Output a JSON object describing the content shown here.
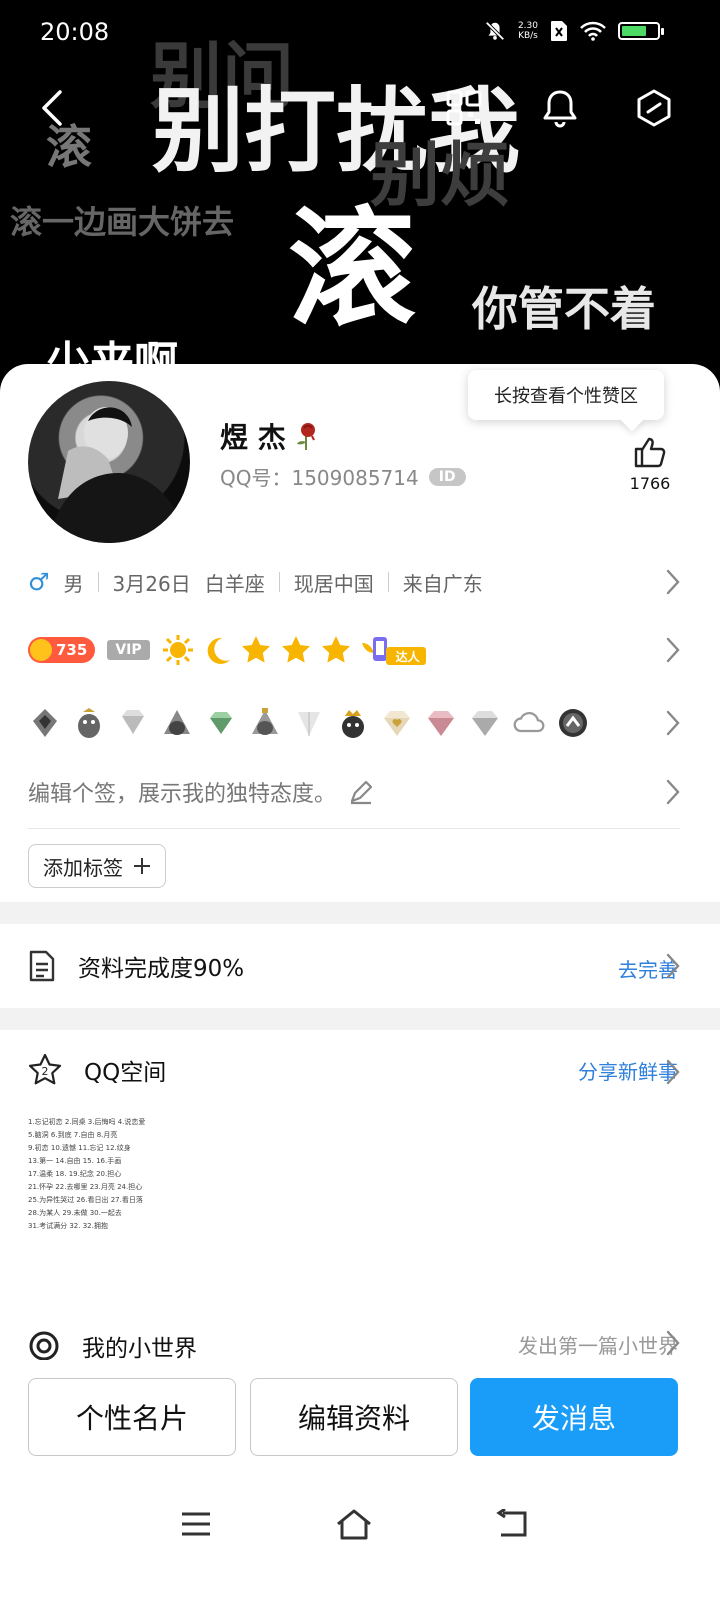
{
  "status_bar": {
    "time": "20:08",
    "speed_value": "2.30",
    "speed_unit": "KB/s"
  },
  "cover": {
    "texts": [
      "别打扰我",
      "别问",
      "滚",
      "别烦",
      "滚一边画大饼去",
      "滚",
      "你管不着",
      "少来啊"
    ],
    "icons": {
      "back": "back-arrow-icon",
      "qr": "qr-code-icon",
      "bell": "bell-icon",
      "more": "hexagon-menu-icon"
    }
  },
  "profile": {
    "nickname": "煜 杰",
    "nickname_icon": "wilted-rose-icon",
    "qq_label": "QQ号：1509085714",
    "id_badge": "ID",
    "like_tooltip": "长按查看个性赞区",
    "like_count": "1766",
    "info": {
      "gender_symbol": "♂",
      "gender": "男",
      "birthday": "3月26日",
      "zodiac": "白羊座",
      "location": "现居中国",
      "hometown": "来自广东"
    },
    "level_number": "735",
    "vip_label": "VIP",
    "daren_label": "达人",
    "signature_placeholder": "编辑个签，展示我的独特态度。",
    "add_tag_label": "添加标签"
  },
  "completeness": {
    "label": "资料完成度90%",
    "action": "去完善"
  },
  "qzone": {
    "title": "QQ空间",
    "action": "分享新鲜事",
    "thumb_lines": [
      "1.忘记初恋  2.同桌  3.后悔吗  4.说恋爱",
      "5.脑洞  6.到底  7.自由  8.月亮",
      "9.初恋  10.遗憾  11.忘记  12.纹身",
      "13.第一  14.自由  15.  16.手画",
      "17.温柔  18.  19.纪念  20.担心",
      "21.怀孕  22.去哪里  23.月亮  24.担心",
      "25.为异性哭过  26.看日出  27.看日落",
      "28.为某人  29.未做  30.一起去",
      "31.考试满分  32.  32.拥抱"
    ]
  },
  "xiaoshijie": {
    "title": "我的小世界",
    "action": "发出第一篇小世界"
  },
  "bottom_buttons": {
    "card": "个性名片",
    "edit": "编辑资料",
    "message": "发消息"
  }
}
